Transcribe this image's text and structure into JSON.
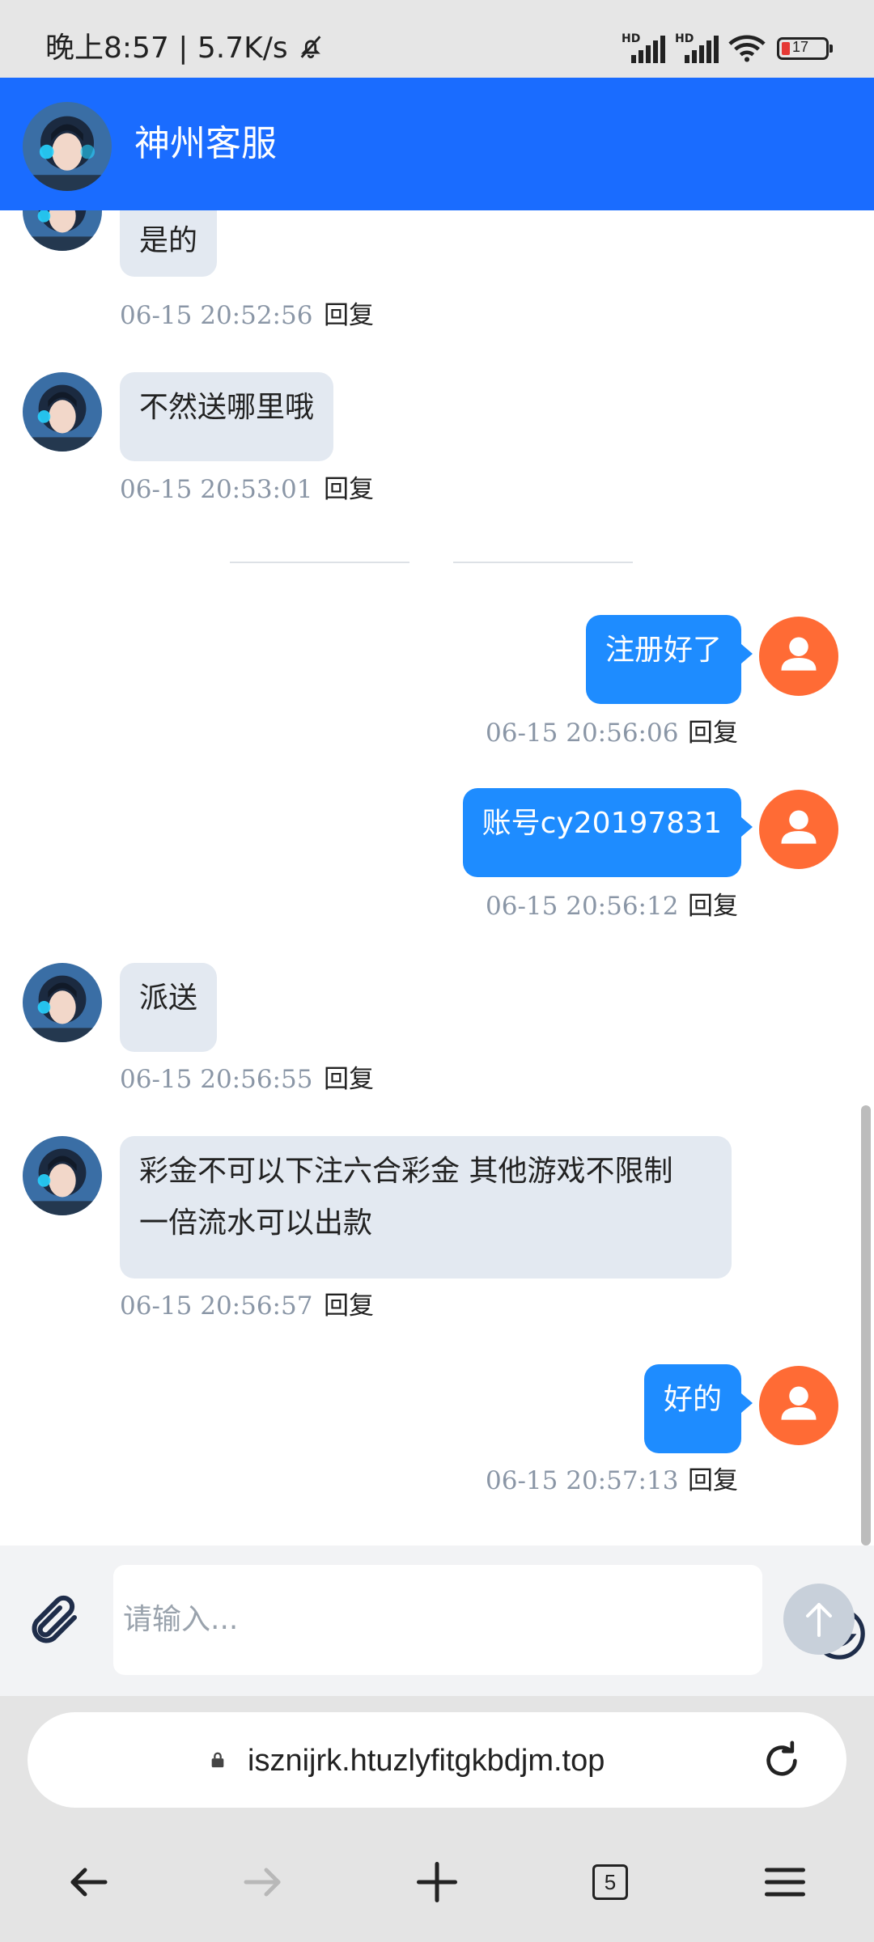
{
  "status_bar": {
    "text": "晚上8:57 | 5.7K/s",
    "battery": "17",
    "signal_label": "HD"
  },
  "header": {
    "title": "神州客服"
  },
  "messages": [
    {
      "side": "in",
      "text": "是的",
      "time": "06-15 20:52:56",
      "reply": "回复"
    },
    {
      "side": "in",
      "text": "不然送哪里哦",
      "time": "06-15 20:53:01",
      "reply": "回复"
    },
    {
      "side": "out",
      "text": "注册好了",
      "time": "06-15 20:56:06",
      "reply": "回复"
    },
    {
      "side": "out",
      "text": "账号cy20197831",
      "time": "06-15 20:56:12",
      "reply": "回复"
    },
    {
      "side": "in",
      "text": "派送",
      "time": "06-15 20:56:55",
      "reply": "回复"
    },
    {
      "side": "in",
      "text_line1": "彩金不可以下注六合彩金 其他游戏不限制",
      "text_line2": "一倍流水可以出款",
      "time": "06-15 20:56:57",
      "reply": "回复"
    },
    {
      "side": "out",
      "text": "好的",
      "time": "06-15 20:57:13",
      "reply": "回复"
    }
  ],
  "input": {
    "placeholder": "请输入..."
  },
  "browser": {
    "url": "isznijrk.htuzlyfitgkbdjm.top",
    "tab_count": "5"
  },
  "colors": {
    "header": "#1a6cff",
    "bubble_out": "#1e8cff",
    "bubble_in": "#e3e9f1",
    "user_avatar": "#ff6b35"
  }
}
